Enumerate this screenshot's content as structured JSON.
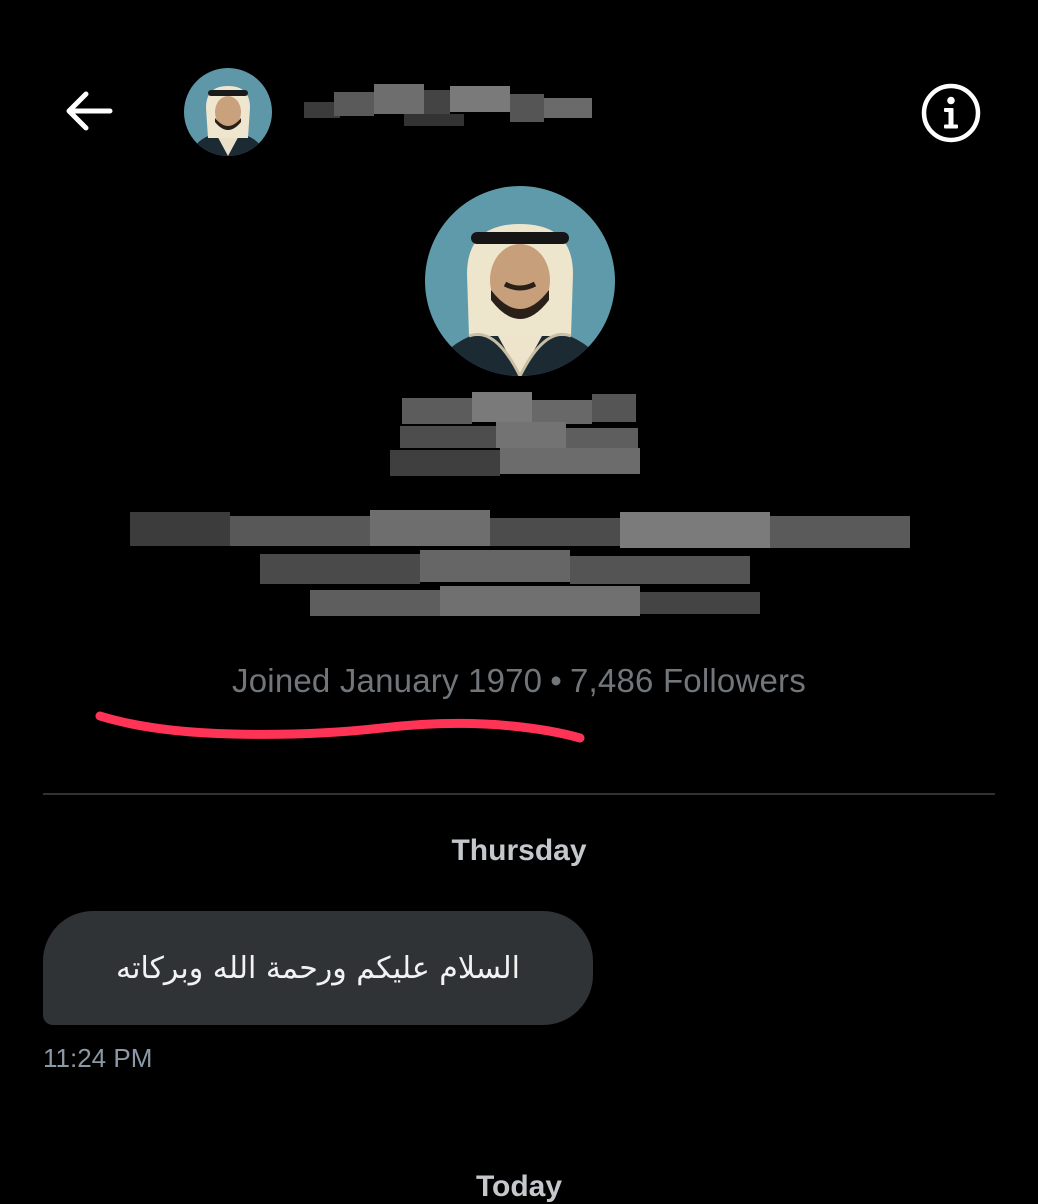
{
  "header": {
    "back_icon": "arrow-left-icon",
    "info_icon": "info-circle-icon"
  },
  "profile": {
    "joined": "Joined January 1970",
    "separator": "•",
    "followers": "7,486 Followers"
  },
  "conversation": {
    "day_labels": [
      "Thursday",
      "Today"
    ],
    "messages": [
      {
        "text": "السلام عليكم ورحمة الله وبركاته",
        "time": "11:24 PM"
      }
    ]
  },
  "colors": {
    "background": "#000000",
    "bubble": "#2f3336",
    "muted_text": "#71767b",
    "annotation": "#ff3355"
  }
}
